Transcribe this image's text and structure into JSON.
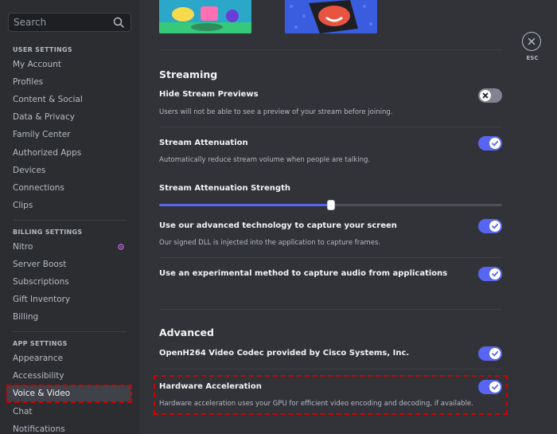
{
  "search": {
    "placeholder": "Search"
  },
  "sidebar": {
    "user_settings_header": "USER SETTINGS",
    "user_items": [
      "My Account",
      "Profiles",
      "Content & Social",
      "Data & Privacy",
      "Family Center",
      "Authorized Apps",
      "Devices",
      "Connections",
      "Clips"
    ],
    "billing_settings_header": "BILLING SETTINGS",
    "billing_items": [
      "Nitro",
      "Server Boost",
      "Subscriptions",
      "Gift Inventory",
      "Billing"
    ],
    "app_settings_header": "APP SETTINGS",
    "app_items": [
      "Appearance",
      "Accessibility",
      "Voice & Video",
      "Chat",
      "Notifications"
    ],
    "active_item": "Voice & Video"
  },
  "main": {
    "streaming_header": "Streaming",
    "hide_previews": {
      "label": "Hide Stream Previews",
      "desc": "Users will not be able to see a preview of your stream before joining.",
      "enabled": false
    },
    "attenuation": {
      "label": "Stream Attenuation",
      "desc": "Automatically reduce stream volume when people are talking.",
      "enabled": true
    },
    "attenuation_strength": {
      "label": "Stream Attenuation Strength",
      "value_percent": 50
    },
    "capture_screen": {
      "label": "Use our advanced technology to capture your screen",
      "desc": "Our signed DLL is injected into the application to capture frames.",
      "enabled": true
    },
    "capture_audio": {
      "label": "Use an experimental method to capture audio from applications",
      "enabled": true
    },
    "advanced_header": "Advanced",
    "openh264": {
      "label": "OpenH264 Video Codec provided by Cisco Systems, Inc.",
      "enabled": true
    },
    "hw_accel": {
      "label": "Hardware Acceleration",
      "desc": "Hardware acceleration uses your GPU for efficient video encoding and decoding, if available.",
      "enabled": true
    }
  },
  "esc": {
    "label": "ESC"
  },
  "colors": {
    "accent": "#5865f2",
    "highlight": "#d40000",
    "nitro": "#c061d6"
  }
}
